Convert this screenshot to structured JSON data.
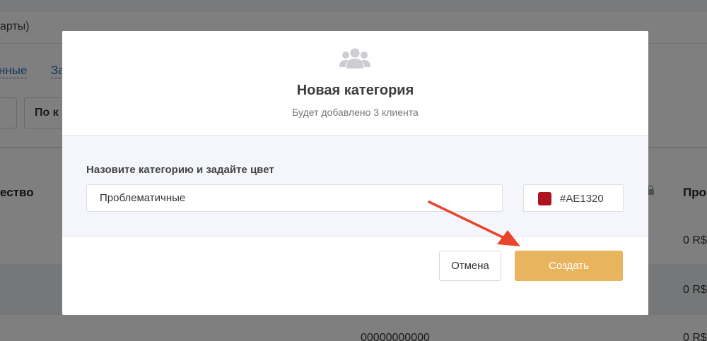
{
  "background": {
    "search_text": "арты)",
    "links": [
      "нные",
      "За"
    ],
    "buttons": [
      "",
      "По к"
    ],
    "headers": [
      "ество",
      "Про"
    ],
    "cells": [
      "0 R$",
      "0 R$",
      "0 R$",
      "00000000000"
    ]
  },
  "modal": {
    "icon": "users-group-icon",
    "title": "Новая категория",
    "subtitle": "Будет добавлено 3 клиента",
    "field_label": "Назовите категорию и задайте цвет",
    "name_value": "Проблематичные",
    "color": {
      "swatch": "#AE1320",
      "hex_label": "#AE1320"
    },
    "cancel_label": "Отмена",
    "create_label": "Создать",
    "create_color": "#E8B55E"
  },
  "annotation": {
    "arrow_color": "#E8452C"
  }
}
